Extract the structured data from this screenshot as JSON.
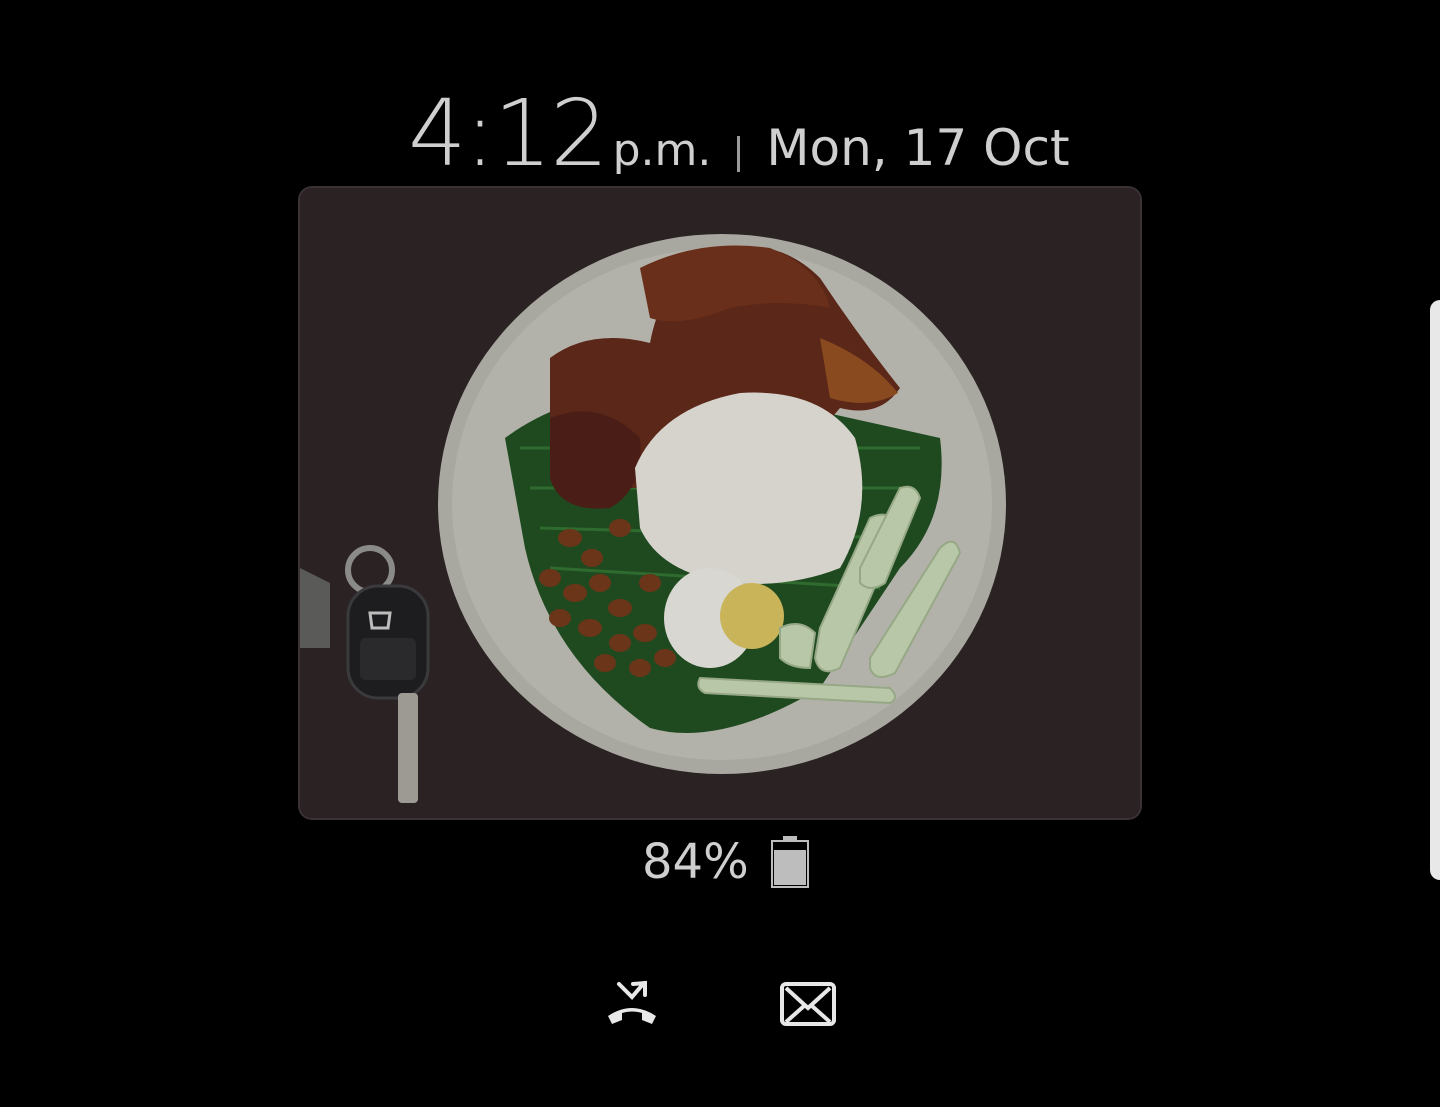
{
  "lockscreen": {
    "time": "4:12",
    "ampm": "p.m.",
    "date": "Mon, 17 Oct",
    "battery_percent": "84%",
    "battery_level": 0.84
  },
  "notifications": {
    "missed_call_icon": "missed-call-icon",
    "message_icon": "envelope-icon"
  },
  "photo": {
    "subject": ""
  }
}
